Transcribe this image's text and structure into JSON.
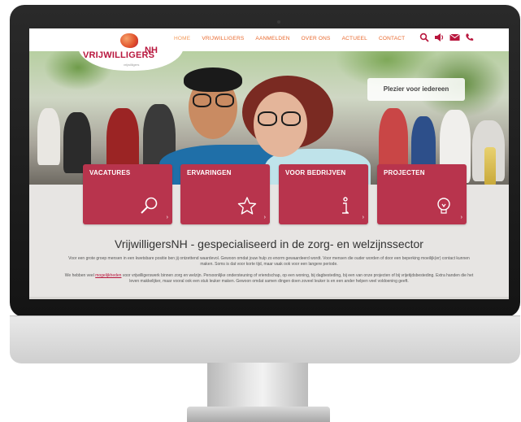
{
  "site": {
    "logo_name": "VRIJWILLIGERS",
    "logo_suffix": "NH",
    "logo_tagline": "vrijwilligers"
  },
  "nav": {
    "items": [
      "HOME",
      "VRIJWILLIGERS",
      "AANMELDEN",
      "OVER ONS",
      "ACTUEEL",
      "CONTACT"
    ],
    "active": "HOME",
    "icons": [
      "search-icon",
      "speaker-icon",
      "mail-icon",
      "phone-icon"
    ]
  },
  "hero": {
    "label": "Plezier voor iedereen"
  },
  "tiles": [
    {
      "title": "VACATURES",
      "icon": "magnifier-icon"
    },
    {
      "title": "ERVARINGEN",
      "icon": "star-icon"
    },
    {
      "title": "VOOR BEDRIJVEN",
      "icon": "info-icon"
    },
    {
      "title": "PROJECTEN",
      "icon": "lightbulb-icon"
    }
  ],
  "main": {
    "heading": "VrijwilligersNH - gespecialiseerd in de zorg- en welzijnssector",
    "para1": "Voor een grote groep mensen in een kwetsbare positie ben jij ontzettend waardevol. Gewoon omdat jouw hulp zo enorm gewaardeerd wordt. Voor mensen die ouder worden of door een beperking moeilijk(er) contact kunnen maken. Soms is dat voor korte tijd, maar vaak ook voor een langere periode.",
    "para2_before": "We hebben veel ",
    "para2_link": "mogelijkheden",
    "para2_after": " voor vrijwilligerswerk binnen zorg en welzijn. Persoonlijke ondersteuning of vriendschap, op een woning, bij dagbesteding, bij een van onze projecten of bij vrijetijdsbesteding. Extra handen die het leven makkelijker, maar vooral ook een stuk leuker maken. Gewoon omdat samen dingen doen zoveel leuker is en een ander helpen veel voldoening geeft."
  },
  "colors": {
    "brand": "#b8163d",
    "tile": "#b8344d",
    "nav": "#e8672b"
  }
}
